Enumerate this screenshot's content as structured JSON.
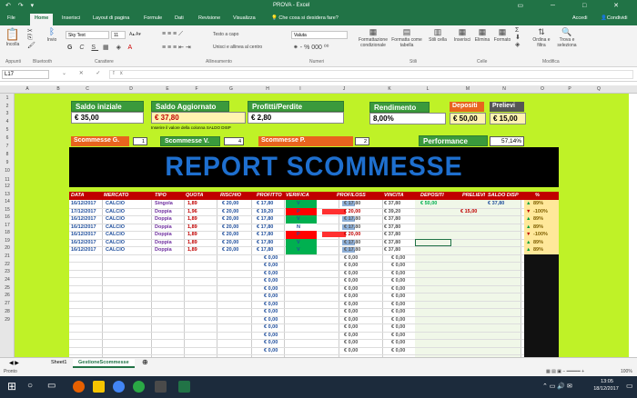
{
  "window": {
    "title": "PROVA - Excel",
    "quick_access": "↶ ↷ ▾",
    "controls": "▭ ─ □ ✕"
  },
  "ribbon_tabs": [
    "File",
    "Home",
    "Inserisci",
    "Layout di pagina",
    "Formule",
    "Dati",
    "Revisione",
    "Visualizza"
  ],
  "tell_me": "Che cosa si desidera fare?",
  "account": {
    "login": "Accedi",
    "share": "Condividi"
  },
  "ribbon": {
    "paste": "Incolla",
    "bluetooth": "Invio",
    "font_name": "Sky Text",
    "font_size": "11",
    "wrap": "Testo a capo",
    "merge": "Unisci e allinea al centro",
    "number_format": "Valuta",
    "cond_format": "Formattazione condizionale",
    "format_table": "Formatta come tabella",
    "styles": "Stili cella",
    "insert": "Inserisci",
    "delete": "Elimina",
    "format": "Formato",
    "sort": "Ordina e filtra",
    "find": "Trova e seleziona",
    "groups": [
      "Appunti",
      "Bluetooth",
      "Carattere",
      "Allineamento",
      "Numeri",
      "Stili",
      "Celle",
      "Modifica"
    ]
  },
  "formula_bar": {
    "name_box": "L17",
    "icons": "⌄ ✕ ✓ fx"
  },
  "columns": [
    "A",
    "B",
    "C",
    "D",
    "E",
    "F",
    "G",
    "H",
    "I",
    "J",
    "K",
    "L",
    "M",
    "N",
    "O",
    "P",
    "Q"
  ],
  "rows": [
    "1",
    "2",
    "3",
    "4",
    "5",
    "6",
    "7",
    "8",
    "9",
    "10",
    "11",
    "12",
    "13",
    "14",
    "15",
    "16",
    "17",
    "18",
    "19",
    "20",
    "21",
    "22",
    "23",
    "24",
    "25",
    "26",
    "27",
    "28",
    "29"
  ],
  "summary": {
    "saldo_iniziale_label": "Saldo iniziale",
    "saldo_iniziale": "€ 35,00",
    "saldo_aggiornato_label": "Saldo Aggiornato",
    "saldo_aggiornato": "€ 37,80",
    "profitti_label": "Profitti/Perdite",
    "profitti": "€ 2,80",
    "rendimento_label": "Rendimento",
    "rendimento": "8,00%",
    "depositi_label": "Depositi",
    "depositi": "€ 50,00",
    "prelievi_label": "Prelievi",
    "prelievi": "€ 15,00",
    "note": "Inserire il valore della colonna SALDO DISP",
    "scommesse_g_label": "Scommesse G.",
    "scommesse_g": "1",
    "scommesse_v_label": "Scommesse V.",
    "scommesse_v": "4",
    "scommesse_p_label": "Scommesse P.",
    "scommesse_p": "2",
    "performance_label": "Performance",
    "performance": "57,14%"
  },
  "report_title": "REPORT SCOMMESSE",
  "table": {
    "headers": [
      "DATA",
      "MERCATO",
      "TIPO",
      "QUOTA",
      "RISCHIO",
      "PROFITTO",
      "VERIFICA",
      "PROFILOSS",
      "VINCITA",
      "DEPOSITI",
      "PRELIEVI",
      "SALDO DISP",
      "%"
    ],
    "rows": [
      [
        "16/12/2017",
        "CALCIO",
        "Singola",
        "1,89",
        "€ 20,00",
        "€ 17,80",
        "V",
        "€ 17,80",
        "€ 37,80",
        "€ 50,00",
        "",
        "€ 37,80",
        "89%"
      ],
      [
        "17/12/2017",
        "CALCIO",
        "Doppia",
        "1,96",
        "€ 20,00",
        "€ 19,20",
        "P",
        "€ 20,00",
        "€ 39,20",
        "",
        "€ 15,00",
        "",
        "-100%"
      ],
      [
        "16/12/2017",
        "CALCIO",
        "Doppia",
        "1,89",
        "€ 20,00",
        "€ 17,80",
        "V",
        "€ 17,80",
        "€ 37,80",
        "",
        "",
        "",
        "89%"
      ],
      [
        "16/12/2017",
        "CALCIO",
        "Doppia",
        "1,89",
        "€ 20,00",
        "€ 17,80",
        "N",
        "€ 17,80",
        "€ 37,80",
        "",
        "",
        "",
        "89%"
      ],
      [
        "16/12/2017",
        "CALCIO",
        "Doppia",
        "1,89",
        "€ 20,00",
        "€ 17,80",
        "P",
        "€ 20,00",
        "€ 37,80",
        "",
        "",
        "",
        "-100%"
      ],
      [
        "16/12/2017",
        "CALCIO",
        "Doppia",
        "1,89",
        "€ 20,00",
        "€ 17,80",
        "V",
        "€ 17,80",
        "€ 37,80",
        "",
        "",
        "",
        "89%"
      ],
      [
        "16/12/2017",
        "CALCIO",
        "Doppia",
        "1,89",
        "€ 20,00",
        "€ 17,80",
        "V",
        "€ 17,80",
        "€ 37,80",
        "",
        "",
        "",
        "89%"
      ]
    ],
    "empty_profitto": "€ 0,00",
    "empty_profiloss": "€ 0,00",
    "empty_vincita": "€ 0,00"
  },
  "sheet_tabs": [
    "Sheet1",
    "GestioneScommesse"
  ],
  "status": {
    "ready": "Pronto",
    "zoom": "100%"
  },
  "taskbar": {
    "time": "13:05",
    "date": "18/12/2017"
  },
  "colors": {
    "excel_green": "#217346",
    "lime": "#bff227",
    "header_red": "#c00000",
    "win_green": "#00b050",
    "loss_red": "#ff0000"
  }
}
